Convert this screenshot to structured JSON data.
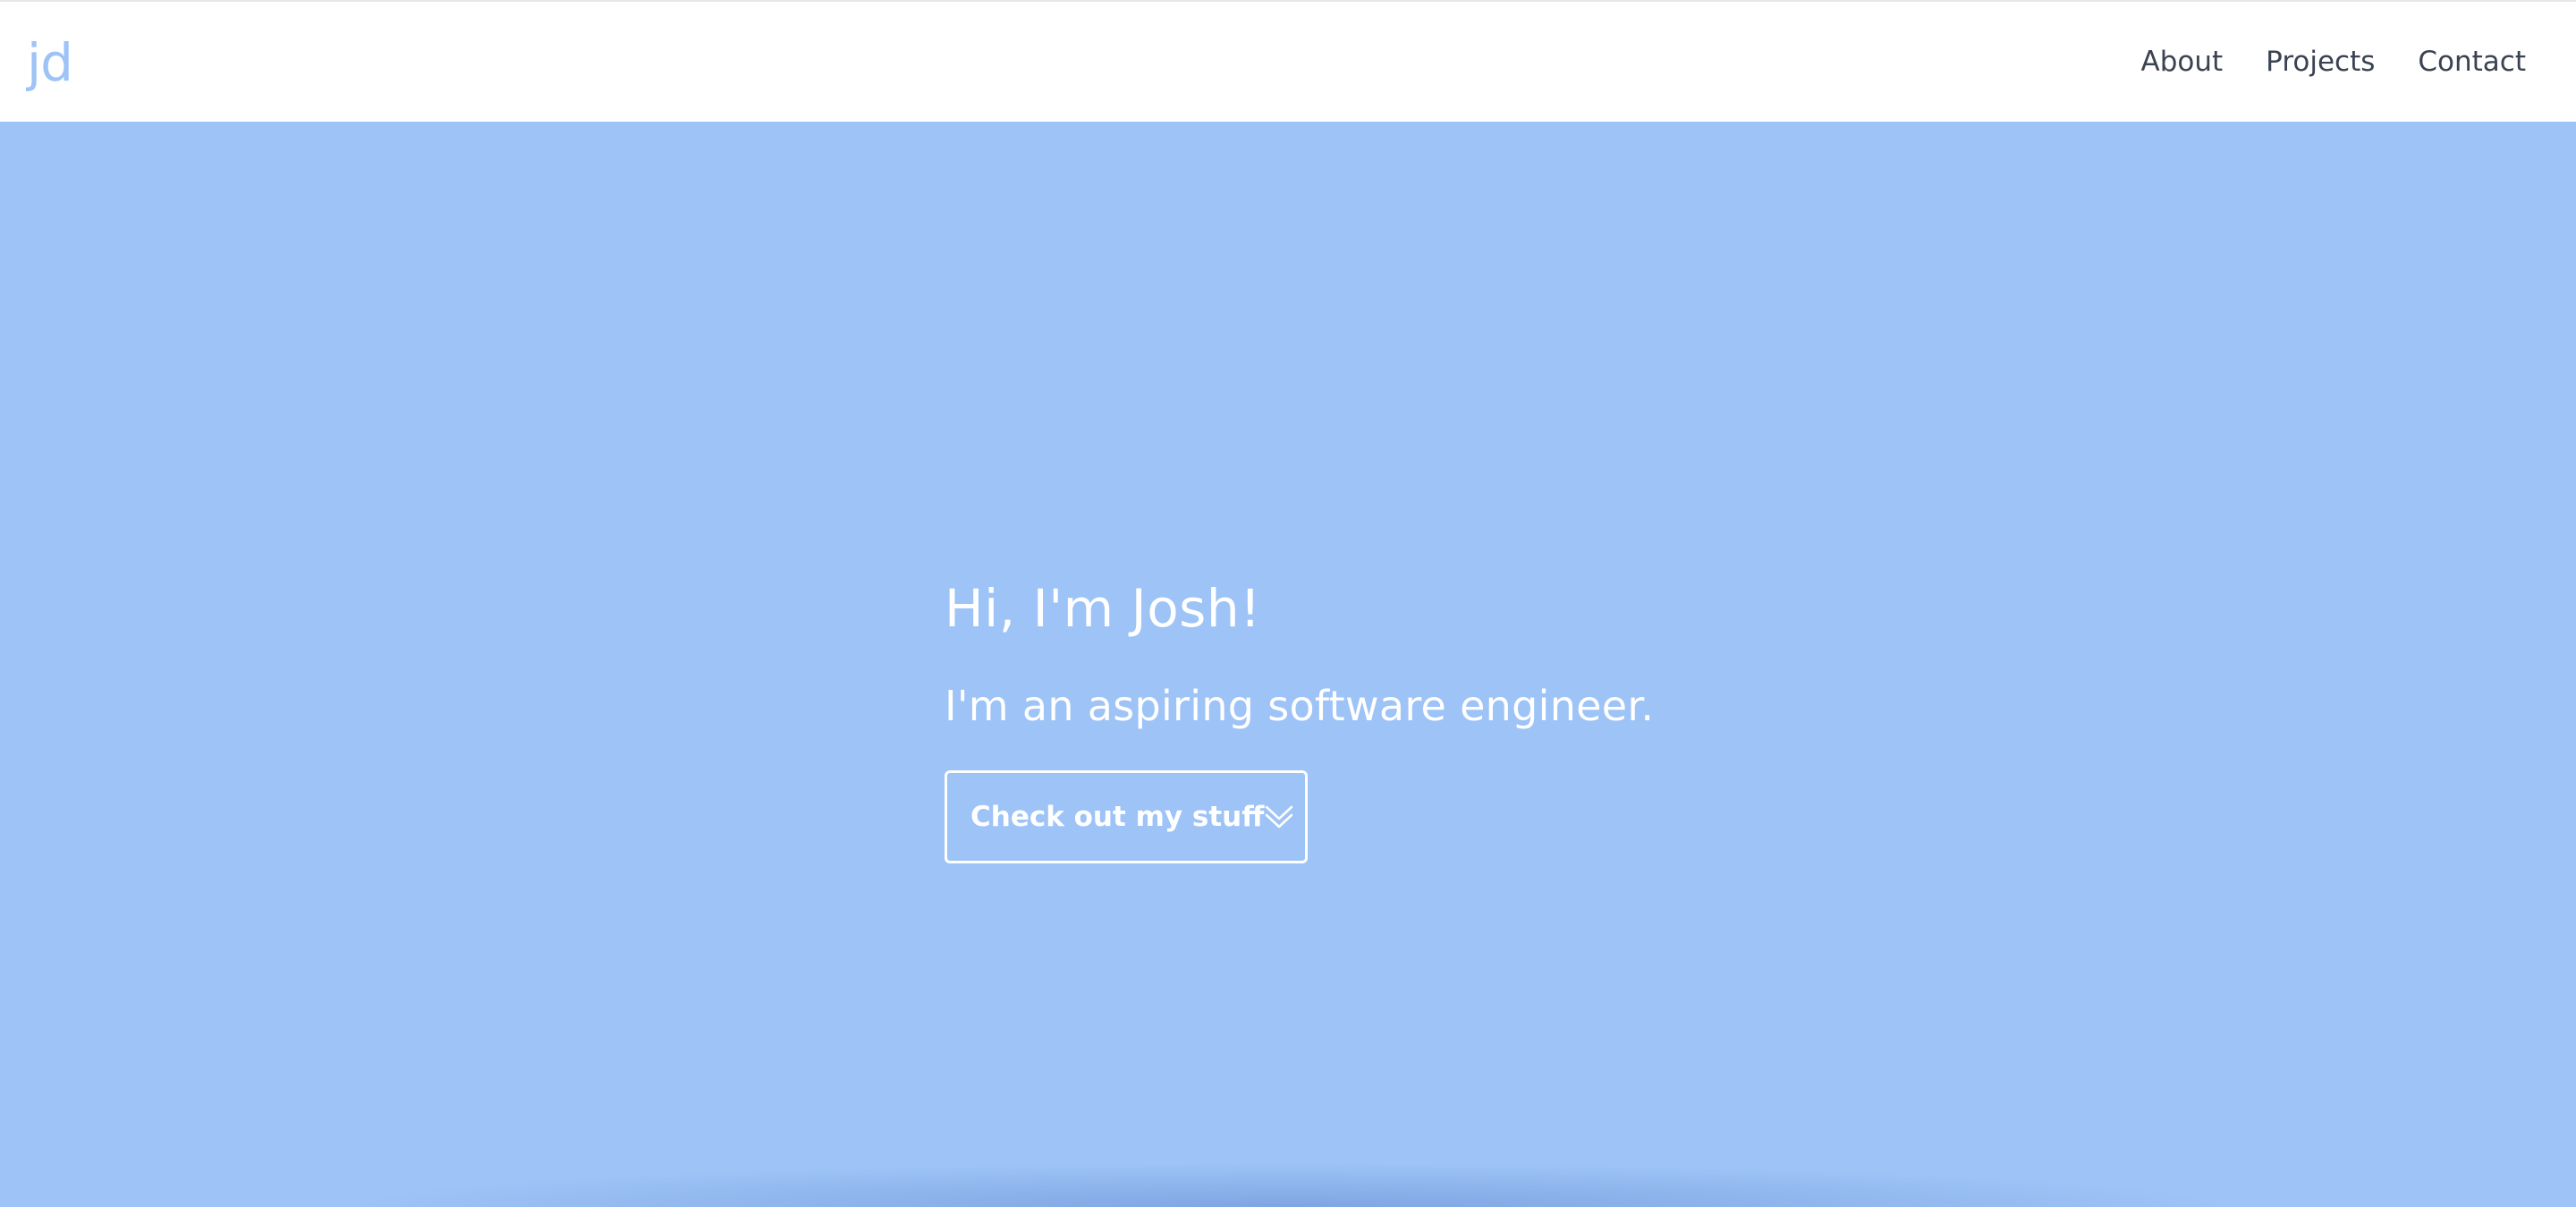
{
  "navbar": {
    "logo_text": "jd",
    "links": [
      {
        "label": "About"
      },
      {
        "label": "Projects"
      },
      {
        "label": "Contact"
      }
    ]
  },
  "hero": {
    "title": "Hi, I'm Josh!",
    "subtitle": "I'm an aspiring software engineer.",
    "cta_label": "Check out my stuff",
    "cta_icon": "double-chevron-down-icon"
  },
  "colors": {
    "accent": "#9dc3f7",
    "nav_text": "#3b4252",
    "hero_text": "#ffffff",
    "navbar_bg": "#ffffff"
  }
}
